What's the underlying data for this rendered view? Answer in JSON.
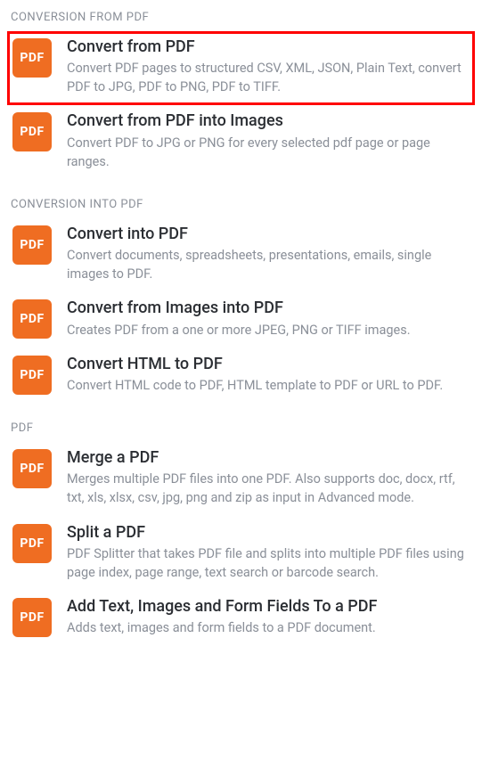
{
  "icon_label": "PDF",
  "sections": [
    {
      "header": "CONVERSION FROM PDF",
      "items": [
        {
          "id": "convert-from-pdf",
          "title": "Convert from PDF",
          "description": "Convert PDF pages to structured CSV, XML, JSON, Plain Text, convert PDF to JPG, PDF to PNG, PDF to TIFF.",
          "highlighted": true
        },
        {
          "id": "convert-from-pdf-images",
          "title": "Convert from PDF into Images",
          "description": "Convert PDF to JPG or PNG for every selected pdf page or page ranges."
        }
      ]
    },
    {
      "header": "CONVERSION INTO PDF",
      "items": [
        {
          "id": "convert-into-pdf",
          "title": "Convert into PDF",
          "description": "Convert documents, spreadsheets, presentations, emails, single images to PDF."
        },
        {
          "id": "convert-images-into-pdf",
          "title": "Convert from Images into PDF",
          "description": "Creates PDF from a one or more JPEG, PNG or TIFF images."
        },
        {
          "id": "convert-html-to-pdf",
          "title": "Convert HTML to PDF",
          "description": "Convert HTML code to PDF, HTML template to PDF or URL to PDF."
        }
      ]
    },
    {
      "header": "PDF",
      "items": [
        {
          "id": "merge-pdf",
          "title": "Merge a PDF",
          "description": "Merges multiple PDF files into one PDF. Also supports doc, docx, rtf, txt, xls, xlsx, csv, jpg, png and zip as input in Advanced mode."
        },
        {
          "id": "split-pdf",
          "title": "Split a PDF",
          "description": "PDF Splitter that takes PDF file and splits into multiple PDF files using page index, page range, text search or barcode search."
        },
        {
          "id": "add-text-images-form-fields",
          "title": "Add Text, Images and Form Fields To a PDF",
          "description": "Adds text, images and form fields to a PDF document."
        }
      ]
    }
  ]
}
